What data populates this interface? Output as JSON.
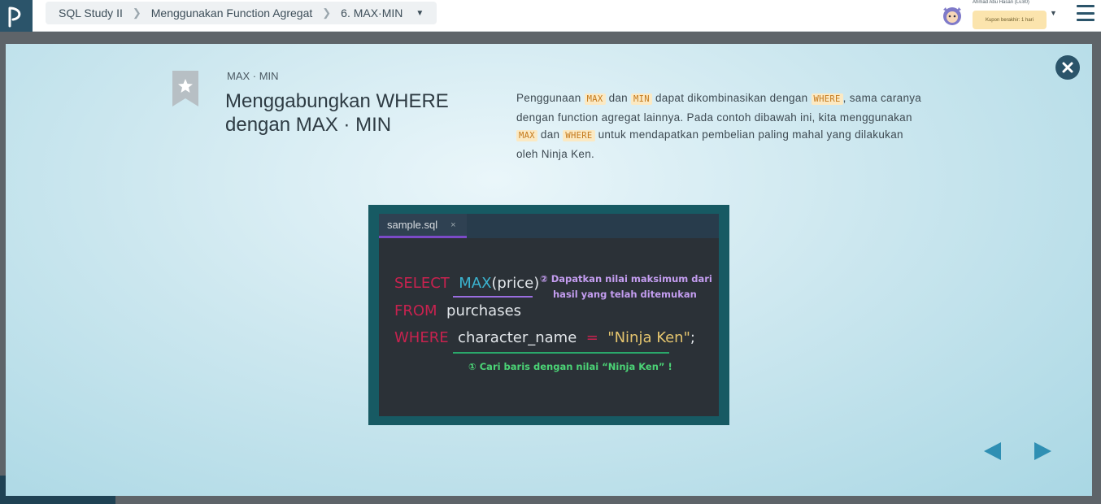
{
  "header": {
    "breadcrumb": [
      "SQL Study II",
      "Menggunakan Function Agregat",
      "6. MAX·MIN"
    ],
    "user_name": "Ahmad Abu Hasan (Lv.80)",
    "coupon": "Kupon berakhir: 1 hari",
    "icons": [
      "logo-icon",
      "chevron-right-icon",
      "caret-down-icon",
      "avatar-icon",
      "menu-icon"
    ]
  },
  "slide": {
    "subtitle": "MAX · MIN",
    "title": "Menggabungkan WHERE dengan MAX · MIN",
    "description": {
      "t1": "Penggunaan ",
      "c1": "MAX",
      "t2": " dan ",
      "c2": "MIN",
      "t3": " dapat dikombinasikan dengan ",
      "c3": "WHERE",
      "t4": ", sama caranya dengan function agregat lainnya. Pada contoh dibawah ini, kita menggunakan ",
      "c4": "MAX",
      "t5": " dan ",
      "c5": "WHERE",
      "t6": " untuk mendapatkan pembelian paling mahal yang dilakukan oleh Ninja Ken."
    }
  },
  "editor": {
    "tab_name": "sample.sql",
    "tab_close": "×",
    "lines": {
      "kw1": "SELECT",
      "fn1": "MAX",
      "arg1": "(price)",
      "kw2": "FROM",
      "table": "purchases",
      "kw3": "WHERE",
      "col": "character_name",
      "op": "=",
      "str": "\"Ninja Ken\"",
      "end": ";"
    },
    "note_max_line1": "② Dapatkan nilai maksimum dari",
    "note_max_line2": "hasil yang telah ditemukan",
    "note_where": "① Cari baris dengan nilai “Ninja Ken” !"
  },
  "colors": {
    "header_logo_bg": "#2b546a",
    "accent": "#2f8fb3",
    "code_bg": "#fbe9c3",
    "code_text": "#c4791c"
  }
}
